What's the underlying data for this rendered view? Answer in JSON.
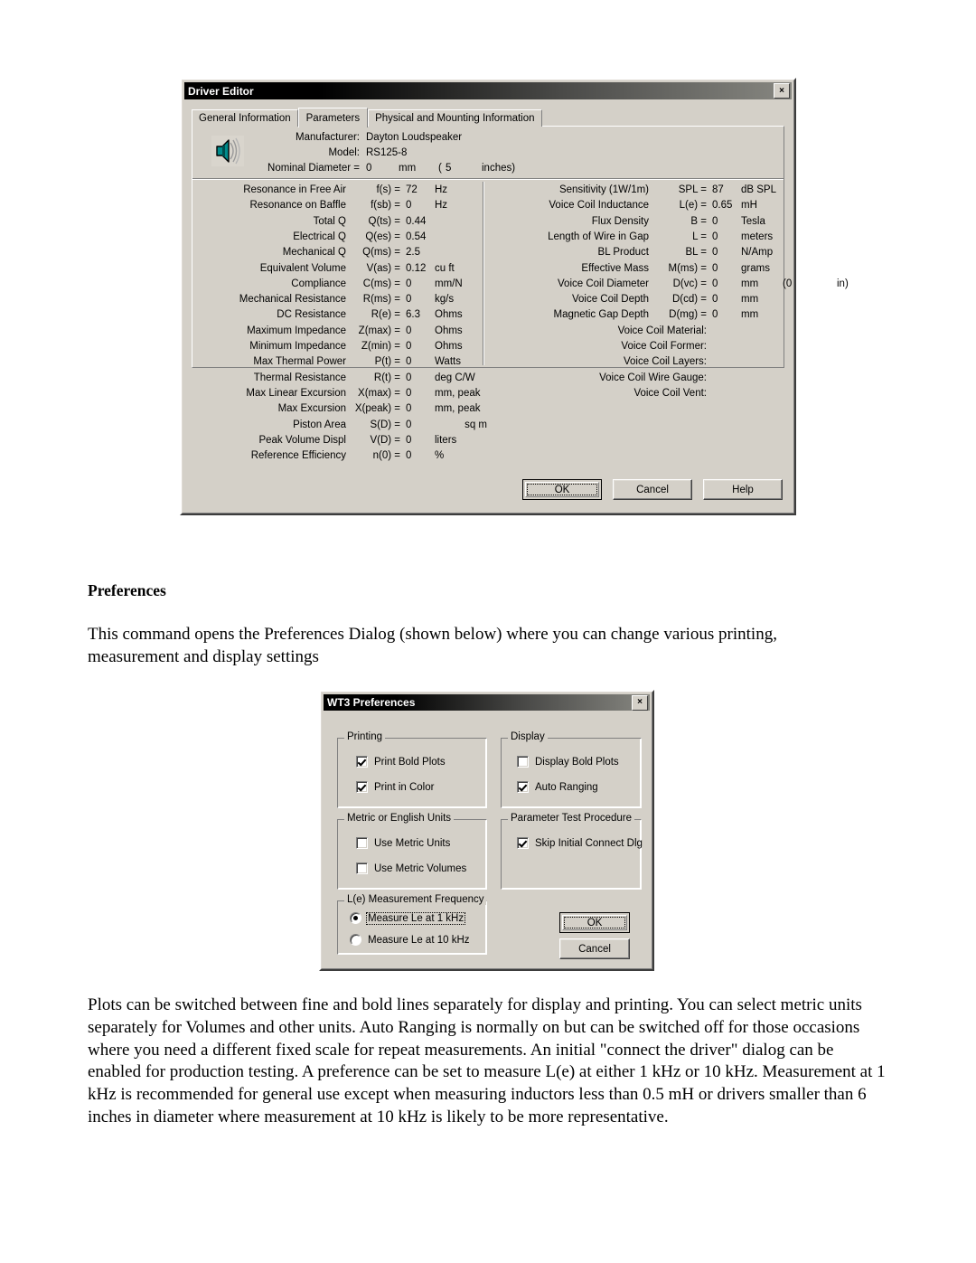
{
  "document": {
    "heading": "Preferences",
    "paragraph_1": "This command opens the Preferences Dialog (shown below) where you can change various printing, measurement and display settings",
    "paragraph_2": "Plots can be switched between fine and bold lines separately for display and printing. You can select metric units separately for Volumes and other units. Auto Ranging is normally on but can be switched off for those occasions where you need a different fixed scale for repeat measurements. An initial \"connect the driver\" dialog can be enabled for production testing. A preference can be set to measure L(e) at either 1 kHz or 10 kHz. Measurement at 1 kHz is recommended for general use except when measuring inductors less than 0.5 mH or drivers smaller than 6 inches in diameter where measurement at 10 kHz is likely to be more representative."
  },
  "driver_editor": {
    "title": "Driver Editor",
    "close_label": "×",
    "tabs": [
      {
        "label": "General Information",
        "active": false
      },
      {
        "label": "Parameters",
        "active": true
      },
      {
        "label": "Physical and Mounting Information",
        "active": false
      }
    ],
    "header": {
      "manufacturer_label": "Manufacturer:",
      "manufacturer_value": "Dayton Loudspeaker",
      "model_label": "Model:",
      "model_value": "RS125-8",
      "nominal_label": "Nominal Diameter =",
      "nominal_value": "0",
      "nominal_unit": "mm",
      "nominal_alt_open": "(",
      "nominal_alt_value": "5",
      "nominal_alt_unit": "inches)",
      "icon": "speaker-icon"
    },
    "left_params": [
      {
        "name": "Resonance in Free Air",
        "symbol": "f(s) =",
        "value": "72",
        "unit": "Hz"
      },
      {
        "name": "Resonance on Baffle",
        "symbol": "f(sb) =",
        "value": "0",
        "unit": "Hz"
      },
      {
        "name": "Total Q",
        "symbol": "Q(ts) =",
        "value": "0.44",
        "unit": ""
      },
      {
        "name": "Electrical Q",
        "symbol": "Q(es) =",
        "value": "0.54",
        "unit": ""
      },
      {
        "name": "Mechanical Q",
        "symbol": "Q(ms) =",
        "value": "2.5",
        "unit": ""
      },
      {
        "name": "Equivalent Volume",
        "symbol": "V(as) =",
        "value": "0.12",
        "unit": "cu ft"
      },
      {
        "name": "Compliance",
        "symbol": "C(ms) =",
        "value": "0",
        "unit": "mm/N"
      },
      {
        "name": "Mechanical Resistance",
        "symbol": "R(ms) =",
        "value": "0",
        "unit": "kg/s"
      },
      {
        "name": "DC Resistance",
        "symbol": "R(e) =",
        "value": "6.3",
        "unit": "Ohms"
      },
      {
        "name": "Maximum Impedance",
        "symbol": "Z(max) =",
        "value": "0",
        "unit": "Ohms"
      },
      {
        "name": "Minimum Impedance",
        "symbol": "Z(min) =",
        "value": "0",
        "unit": "Ohms"
      },
      {
        "name": "Max Thermal Power",
        "symbol": "P(t) =",
        "value": "0",
        "unit": "Watts"
      },
      {
        "name": "Thermal Resistance",
        "symbol": "R(t) =",
        "value": "0",
        "unit": "deg C/W"
      },
      {
        "name": "Max Linear Excursion",
        "symbol": "X(max) =",
        "value": "0",
        "unit": "mm, peak"
      },
      {
        "name": "Max Excursion",
        "symbol": "X(peak) =",
        "value": "0",
        "unit": "mm, peak"
      },
      {
        "name": "Piston Area",
        "symbol": "S(D) =",
        "value": "0",
        "unit": "sq m",
        "unit_right": true
      },
      {
        "name": "Peak Volume Displ",
        "symbol": "V(D) =",
        "value": "0",
        "unit": "liters"
      },
      {
        "name": "Reference Efficiency",
        "symbol": "n(0) =",
        "value": "0",
        "unit": "%"
      }
    ],
    "right_params": [
      {
        "name": "Sensitivity (1W/1m)",
        "symbol": "SPL =",
        "value": "87",
        "unit": "dB SPL"
      },
      {
        "name": "Voice Coil Inductance",
        "symbol": "L(e) =",
        "value": "0.65",
        "unit": "mH"
      },
      {
        "name": "Flux Density",
        "symbol": "B =",
        "value": "0",
        "unit": "Tesla"
      },
      {
        "name": "Length of Wire in Gap",
        "symbol": "L =",
        "value": "0",
        "unit": "meters"
      },
      {
        "name": "BL Product",
        "symbol": "BL =",
        "value": "0",
        "unit": "N/Amp"
      },
      {
        "name": "Effective Mass",
        "symbol": "M(ms) =",
        "value": "0",
        "unit": "grams"
      },
      {
        "name": "Voice Coil Diameter",
        "symbol": "D(vc) =",
        "value": "0",
        "unit": "mm",
        "extra_open": "(0",
        "extra_close": "in)"
      },
      {
        "name": "Voice Coil Depth",
        "symbol": "D(cd) =",
        "value": "0",
        "unit": "mm"
      },
      {
        "name": "Magnetic Gap Depth",
        "symbol": "D(mg) =",
        "value": "0",
        "unit": "mm"
      }
    ],
    "right_text_rows": [
      "Voice Coil Material:",
      "Voice Coil Former:",
      "Voice Coil Layers:",
      "Voice Coil Wire Gauge:",
      "Voice Coil Vent:"
    ],
    "buttons": {
      "ok": "OK",
      "cancel": "Cancel",
      "help": "Help"
    }
  },
  "preferences": {
    "title": "WT3 Preferences",
    "close_label": "×",
    "groups": {
      "printing": {
        "label": "Printing",
        "items": [
          {
            "label": "Print Bold Plots",
            "checked": true
          },
          {
            "label": "Print in Color",
            "checked": true
          }
        ]
      },
      "display": {
        "label": "Display",
        "items": [
          {
            "label": "Display Bold Plots",
            "checked": false
          },
          {
            "label": "Auto Ranging",
            "checked": true
          }
        ]
      },
      "units": {
        "label": "Metric or English Units",
        "items": [
          {
            "label": "Use Metric Units",
            "checked": false
          },
          {
            "label": "Use Metric Volumes",
            "checked": false
          }
        ]
      },
      "test_procedure": {
        "label": "Parameter Test Procedure",
        "items": [
          {
            "label": "Skip Initial Connect Dlg",
            "checked": true
          }
        ]
      },
      "le_frequency": {
        "label": "L(e) Measurement Frequency",
        "items": [
          {
            "label": "Measure Le at 1 kHz",
            "selected": true
          },
          {
            "label": "Measure Le at 10 kHz",
            "selected": false
          }
        ]
      }
    },
    "buttons": {
      "ok": "OK",
      "cancel": "Cancel"
    }
  },
  "colors": {
    "dialog_face": "#d4d0c8",
    "titlebar_start": "#000000",
    "titlebar_end": "#878781",
    "speaker_icon": "#008080",
    "text": "#000000"
  }
}
